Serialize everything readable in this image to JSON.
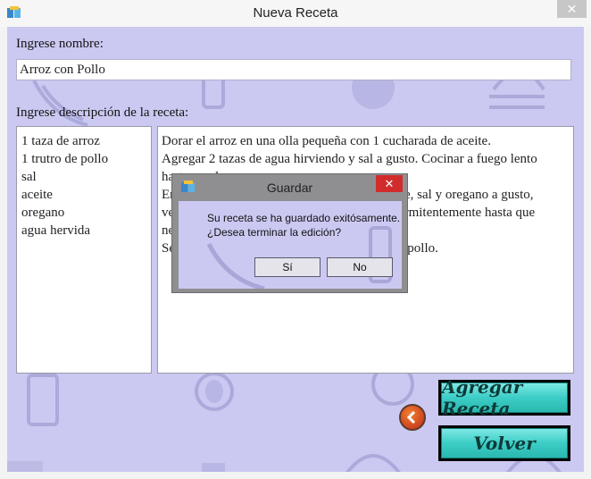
{
  "window": {
    "title": "Nueva Receta",
    "close_glyph": "✕",
    "app_icon": "recipe-book-icon"
  },
  "form": {
    "name_label": "Ingrese nombre:",
    "name_value": "Arroz con Pollo",
    "description_label": "Ingrese descripción de la receta:",
    "ingredients": [
      "1 taza de arroz",
      "1 trutro de pollo",
      "sal",
      "aceite",
      "oregano",
      "agua hervida"
    ],
    "description_lines": [
      "Dorar el arroz en una olla pequeña con 1 cucharada de aceite.",
      "Agregar 2 tazas de agua hirviendo y sal a gusto. Cocinar a fuego lento",
      "hasta que la",
      "En otra olla ponga el trutro de pollo con aceite, sal y oregano a gusto,",
      "ver que el pollo este dorado, revolviendo intermitentemente hasta que",
      "ne",
      "Se sirve el arroz acompañado con el trutro de pollo."
    ]
  },
  "buttons": {
    "add_recipe": "Agregar Receta",
    "back": "Volver"
  },
  "dialog": {
    "title": "Guardar",
    "close_glyph": "✕",
    "message_line1": "Su receta se ha guardado exitósamente.",
    "message_line2": "¿Desea terminar la edición?",
    "yes_label": "Sí",
    "no_label": "No"
  },
  "colors": {
    "background": "#cbc9f1",
    "button_teal": "#3ccdc6",
    "dialog_close": "#d12c2c"
  }
}
